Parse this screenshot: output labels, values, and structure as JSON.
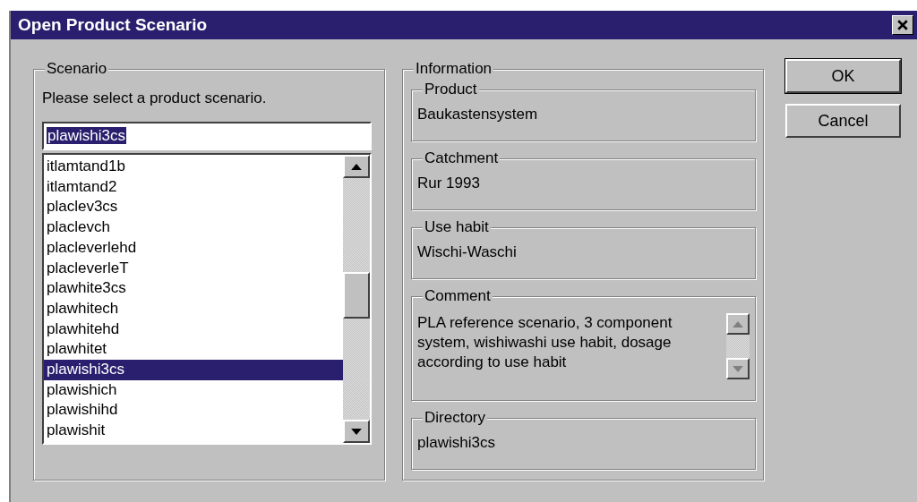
{
  "window": {
    "title": "Open Product Scenario"
  },
  "scenario": {
    "label": "Scenario",
    "prompt": "Please select a product scenario.",
    "input": {
      "value": "plawishi3cs",
      "text_selected": true
    },
    "list": {
      "items": [
        {
          "label": "itlamtand1b",
          "selected": false
        },
        {
          "label": "itlamtand2",
          "selected": false
        },
        {
          "label": "placlev3cs",
          "selected": false
        },
        {
          "label": "placlevch",
          "selected": false
        },
        {
          "label": "placleverlehd",
          "selected": false
        },
        {
          "label": "placleverleT",
          "selected": false
        },
        {
          "label": "plawhite3cs",
          "selected": false
        },
        {
          "label": "plawhitech",
          "selected": false
        },
        {
          "label": "plawhitehd",
          "selected": false
        },
        {
          "label": "plawhitet",
          "selected": false
        },
        {
          "label": "plawishi3cs",
          "selected": true
        },
        {
          "label": "plawishich",
          "selected": false
        },
        {
          "label": "plawishihd",
          "selected": false
        },
        {
          "label": "plawishit",
          "selected": false
        }
      ]
    }
  },
  "information": {
    "label": "Information",
    "fields": [
      {
        "label": "Product",
        "value": "Baukastensystem",
        "kind": "single"
      },
      {
        "label": "Catchment",
        "value": "Rur 1993",
        "kind": "single"
      },
      {
        "label": "Use habit",
        "value": "Wischi-Waschi",
        "kind": "single"
      },
      {
        "label": "Comment",
        "value": "PLA reference scenario, 3 component system, wishiwashi use habit, dosage according to use habit",
        "kind": "multiline"
      },
      {
        "label": "Directory",
        "value": "plawishi3cs",
        "kind": "single"
      }
    ]
  },
  "buttons": [
    {
      "label": "OK",
      "default": true
    },
    {
      "label": "Cancel",
      "default": false
    }
  ]
}
